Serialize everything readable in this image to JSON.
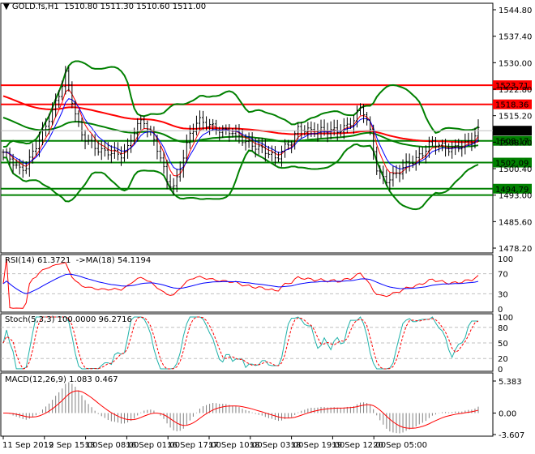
{
  "header": {
    "symbol": "GOLD.fs,H1",
    "ohlc": "1510.80 1511.30 1510.60 1511.00"
  },
  "price_axis": [
    "1544.80",
    "1537.40",
    "1530.00",
    "1522.80",
    "1515.20",
    "1508.00",
    "1500.40",
    "1493.00",
    "1485.60",
    "1478.20"
  ],
  "levels": [
    {
      "value": 1523.71,
      "label": "1523.71",
      "color": "#ff0000"
    },
    {
      "value": 1518.36,
      "label": "1518.36",
      "color": "#ff0000"
    },
    {
      "value": 1508.17,
      "label": "1508.17",
      "color": "#008000"
    },
    {
      "value": 1502.09,
      "label": "1502.09",
      "color": "#008000"
    },
    {
      "value": 1494.79,
      "label": "1494.79",
      "color": "#008000"
    },
    {
      "value": 1493.0,
      "label": "",
      "color": "#008000"
    }
  ],
  "current_price": {
    "value": 1511.0,
    "label": "1511.00"
  },
  "rsi": {
    "title": "RSI(14) 61.3721  ->MA(18) 54.1194",
    "ticks": [
      "100",
      "70",
      "30",
      "0"
    ]
  },
  "stoch": {
    "title": "Stoch(5,3,3) 100.0000 96.2716",
    "ticks": [
      "100",
      "80",
      "50",
      "20",
      "0"
    ]
  },
  "macd": {
    "title": "MACD(12,26,9) 1.083 0.467",
    "ticks": [
      "5.383",
      "0.00",
      "-3.607"
    ]
  },
  "time_axis": [
    "11 Sep 2019",
    "12 Sep 15:00",
    "13 Sep 08:00",
    "16 Sep 01:00",
    "16 Sep 17:00",
    "17 Sep 10:00",
    "18 Sep 03:00",
    "18 Sep 19:00",
    "19 Sep 12:00",
    "20 Sep 05:00"
  ],
  "chart_data": {
    "type": "candlestick",
    "title": "GOLD.fs,H1",
    "ylim": [
      1478.2,
      1544.8
    ],
    "key_closes": [
      1505,
      1503,
      1500,
      1501,
      1506,
      1510,
      1515,
      1520,
      1527,
      1518,
      1510,
      1508,
      1506,
      1505,
      1505,
      1504,
      1506,
      1512,
      1514,
      1510,
      1505,
      1497,
      1495,
      1503,
      1510,
      1514,
      1513,
      1512,
      1511,
      1511,
      1510,
      1508,
      1507,
      1506,
      1505,
      1503,
      1506,
      1508,
      1512,
      1511,
      1511,
      1511,
      1511,
      1511,
      1512,
      1514,
      1518,
      1512,
      1500,
      1497,
      1498,
      1500,
      1502,
      1503,
      1505,
      1508,
      1507,
      1506,
      1506,
      1507,
      1508,
      1511
    ],
    "colors": {
      "bands": "#008000",
      "fast_ma": "#ff0000",
      "slow_ma": "#008000",
      "rsi": "#ff0000",
      "rsi_ma": "#0000ff",
      "stoch_main": "#20b2aa",
      "stoch_signal": "#ff0000",
      "macd": "#808080",
      "macd_signal": "#ff0000"
    }
  }
}
